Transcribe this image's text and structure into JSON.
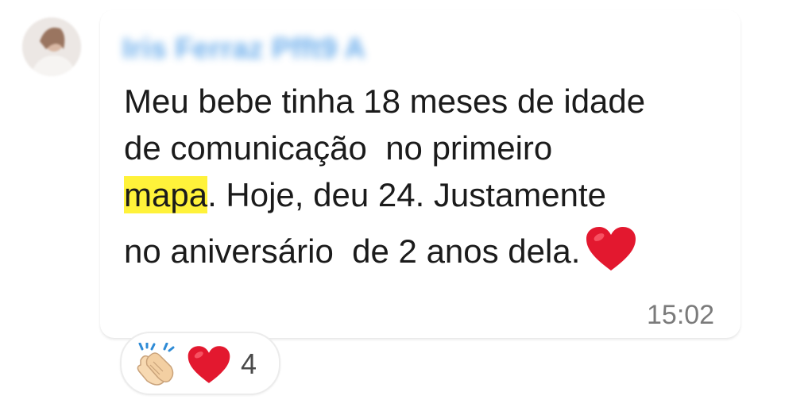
{
  "sender": {
    "name": "Iris Ferraz Pfft9 A"
  },
  "message": {
    "line1": "Meu bebe tinha 18 meses de idade",
    "line2": "de comunicação  no primeiro",
    "line3_highlight": "mapa",
    "line3_rest": ". Hoje, deu 24. Justamente",
    "line4": "no aniversário  de 2 anos dela.",
    "trailing_emoji": "red-heart",
    "time": "15:02"
  },
  "reactions": {
    "emojis": [
      "clapping-hands",
      "red-heart"
    ],
    "count": "4"
  },
  "colors": {
    "highlight": "#fff23a",
    "sender_name": "#4f9ee8",
    "heart": "#e3182f",
    "timestamp": "#7b7b7b"
  }
}
